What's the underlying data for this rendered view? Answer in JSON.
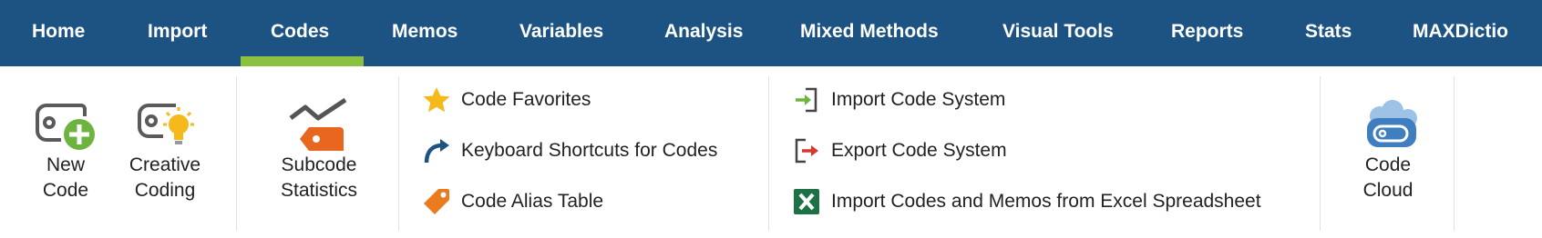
{
  "menu": {
    "tabs": [
      {
        "label": "Home"
      },
      {
        "label": "Import"
      },
      {
        "label": "Codes"
      },
      {
        "label": "Memos"
      },
      {
        "label": "Variables"
      },
      {
        "label": "Analysis"
      },
      {
        "label": "Mixed Methods"
      },
      {
        "label": "Visual Tools"
      },
      {
        "label": "Reports"
      },
      {
        "label": "Stats"
      },
      {
        "label": "MAXDictio"
      }
    ],
    "active_tab": "Codes",
    "accent_color": "#8cc13f",
    "bar_color": "#1d5383"
  },
  "ribbon": {
    "new_code": {
      "line1": "New",
      "line2": "Code",
      "icon": "new-code-icon"
    },
    "creative_coding": {
      "line1": "Creative",
      "line2": "Coding",
      "icon": "creative-coding-icon"
    },
    "subcode_statistics": {
      "line1": "Subcode",
      "line2": "Statistics",
      "icon": "subcode-statistics-icon"
    },
    "code_favorites": {
      "label": "Code Favorites",
      "icon": "star-icon"
    },
    "keyboard_shortcuts": {
      "label": "Keyboard Shortcuts for Codes",
      "icon": "curved-arrow-icon"
    },
    "code_alias_table": {
      "label": "Code Alias Table",
      "icon": "tag-icon"
    },
    "import_code_system": {
      "label": "Import Code System",
      "icon": "import-icon"
    },
    "export_code_system": {
      "label": "Export Code System",
      "icon": "export-icon"
    },
    "import_excel": {
      "label": "Import Codes and Memos from Excel Spreadsheet",
      "icon": "excel-icon"
    },
    "code_cloud": {
      "line1": "Code",
      "line2": "Cloud",
      "icon": "code-cloud-icon"
    }
  }
}
